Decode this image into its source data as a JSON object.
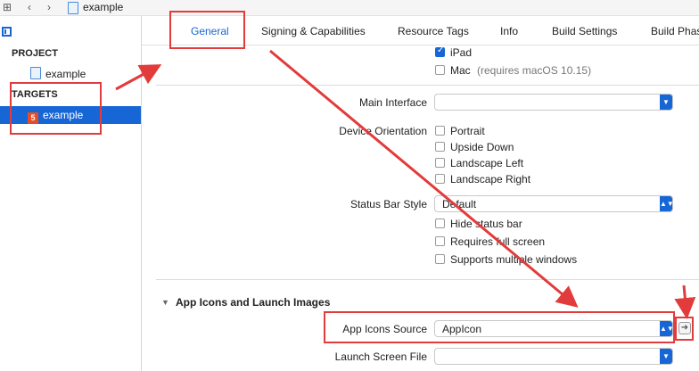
{
  "breadcrumb": {
    "file_label": "example"
  },
  "sidebar": {
    "project_heading": "PROJECT",
    "project_item": "example",
    "targets_heading": "TARGETS",
    "target_item": "example"
  },
  "tabs": [
    "General",
    "Signing & Capabilities",
    "Resource Tags",
    "Info",
    "Build Settings",
    "Build Phas"
  ],
  "deployment": {
    "ipad_label": "iPad",
    "mac_label": "Mac",
    "mac_note": "(requires macOS 10.15)"
  },
  "main_interface": {
    "label": "Main Interface",
    "value": ""
  },
  "device_orientation": {
    "label": "Device Orientation",
    "options": [
      "Portrait",
      "Upside Down",
      "Landscape Left",
      "Landscape Right"
    ]
  },
  "status_bar": {
    "label": "Status Bar Style",
    "value": "Default",
    "options": [
      "Hide status bar",
      "Requires full screen",
      "Supports multiple windows"
    ]
  },
  "app_icons": {
    "section_title": "App Icons and Launch Images",
    "source_label": "App Icons Source",
    "source_value": "AppIcon",
    "launch_label": "Launch Screen File",
    "launch_value": ""
  },
  "colors": {
    "accent": "#1766d6",
    "annotation": "#e23b3b"
  }
}
